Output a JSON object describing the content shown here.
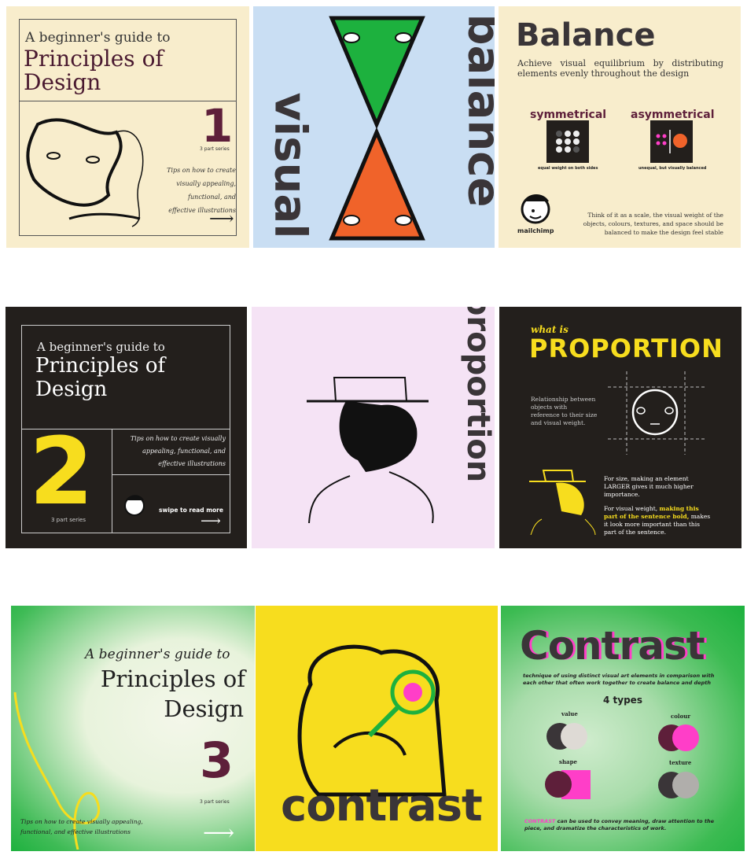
{
  "row1": {
    "cover": {
      "kicker": "A beginner's guide to",
      "title_line1": "Principles of",
      "title_line2": "Design",
      "number": "1",
      "series": "3 part series",
      "tips": "Tips on how to create visually appealing, functional, and effective illustrations",
      "arrow": "⟶"
    },
    "visual_balance": {
      "word1": "visual",
      "word2": "balance"
    },
    "balance": {
      "title": "Balance",
      "subtitle": "Achieve visual equilibrium by distributing elements evenly throughout the design",
      "sym_label": "symmetrical",
      "sym_caption": "equal weight on both sides",
      "asym_label": "asymmetrical",
      "asym_caption": "unequal, but visually balanced",
      "brand": "mailchimp",
      "body": "Think of it as a scale, the visual weight of the objects, colours, textures, and space  should be balanced to make the design feel stable"
    }
  },
  "row2": {
    "cover": {
      "kicker": "A beginner's guide to",
      "title_line1": "Principles of",
      "title_line2": "Design",
      "number": "2",
      "series": "3 part series",
      "tips": "Tips on how to create visually appealing, functional, and effective illustrations",
      "swipe": "swipe to read more",
      "arrow": "⟶"
    },
    "proportion_word": "proportion",
    "proportion": {
      "kicker": "what is",
      "title": "PROPORTION",
      "definition": "Relationship between objects with reference to their size and visual weight.",
      "size_text": "For size, making an element LARGER gives it much higher importance.",
      "weight_pre": "For visual weight, ",
      "weight_bold": "making this part of the sentence bold,",
      "weight_post": " makes it look more important than this part of the sentence."
    }
  },
  "row3": {
    "cover": {
      "kicker": "A beginner's guide to",
      "title_line1": "Principles of",
      "title_line2": "Design",
      "number": "3",
      "series": "3 part series",
      "tips": "Tips on how to create visually appealing, functional, and effective illustrations",
      "arrow": "⟶"
    },
    "contrast_word": "contrast",
    "contrast": {
      "title": "Contrast",
      "definition": "technique of using distinct visual art elements in comparison with each other that often work together to create balance and depth",
      "types_title": "4 types",
      "types": [
        "value",
        "colour",
        "shape",
        "texture"
      ],
      "footer_highlight": "CONTRAST",
      "footer_rest": " can be used to convey meaning, draw attention to the piece, and dramatize the characteristics of work."
    }
  },
  "colors": {
    "cream": "#f8edcc",
    "maroon": "#5e1f3a",
    "dark": "#231f1c",
    "yellow": "#f7dd1e",
    "green": "#1db13e",
    "pink": "#ff3ec8",
    "orange": "#f0632a",
    "lightblue": "#c9def3",
    "lilac": "#f5e3f5"
  }
}
